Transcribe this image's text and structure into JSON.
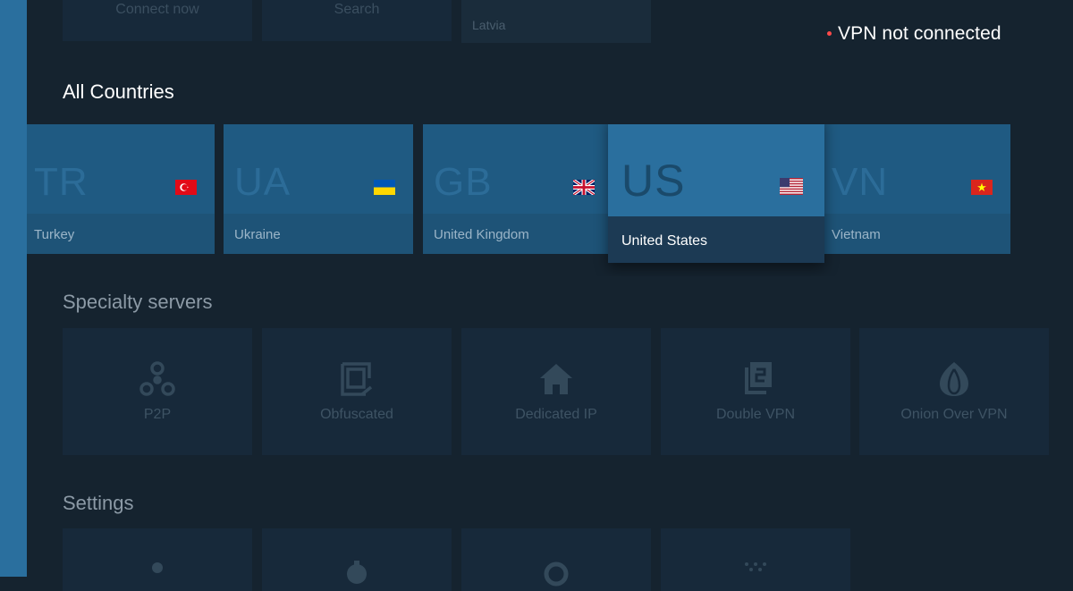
{
  "top_row": {
    "connect_label": "Connect now",
    "search_label": "Search",
    "region_label": "Latvia"
  },
  "status": {
    "text": "VPN not connected",
    "color": "#ff4a4a"
  },
  "sections": {
    "countries_title": "All Countries",
    "specialty_title": "Specialty servers",
    "settings_title": "Settings"
  },
  "countries": [
    {
      "code": "TR",
      "name": "Turkey",
      "flag_icon": "turkey-flag-icon"
    },
    {
      "code": "UA",
      "name": "Ukraine",
      "flag_icon": "ukraine-flag-icon"
    },
    {
      "code": "GB",
      "name": "United Kingdom",
      "flag_icon": "uk-flag-icon"
    },
    {
      "code": "US",
      "name": "United States",
      "flag_icon": "us-flag-icon",
      "focused": true
    },
    {
      "code": "VN",
      "name": "Vietnam",
      "flag_icon": "vietnam-flag-icon"
    }
  ],
  "specialty": [
    {
      "label": "P2P",
      "icon": "p2p-icon"
    },
    {
      "label": "Obfuscated",
      "icon": "obfuscated-icon"
    },
    {
      "label": "Dedicated IP",
      "icon": "home-icon"
    },
    {
      "label": "Double VPN",
      "icon": "double-vpn-icon"
    },
    {
      "label": "Onion Over VPN",
      "icon": "onion-icon"
    }
  ],
  "colors": {
    "background": "#15232f",
    "accent": "#2a6f9e",
    "card": "#1f5a82",
    "dim_card": "#17293a"
  }
}
